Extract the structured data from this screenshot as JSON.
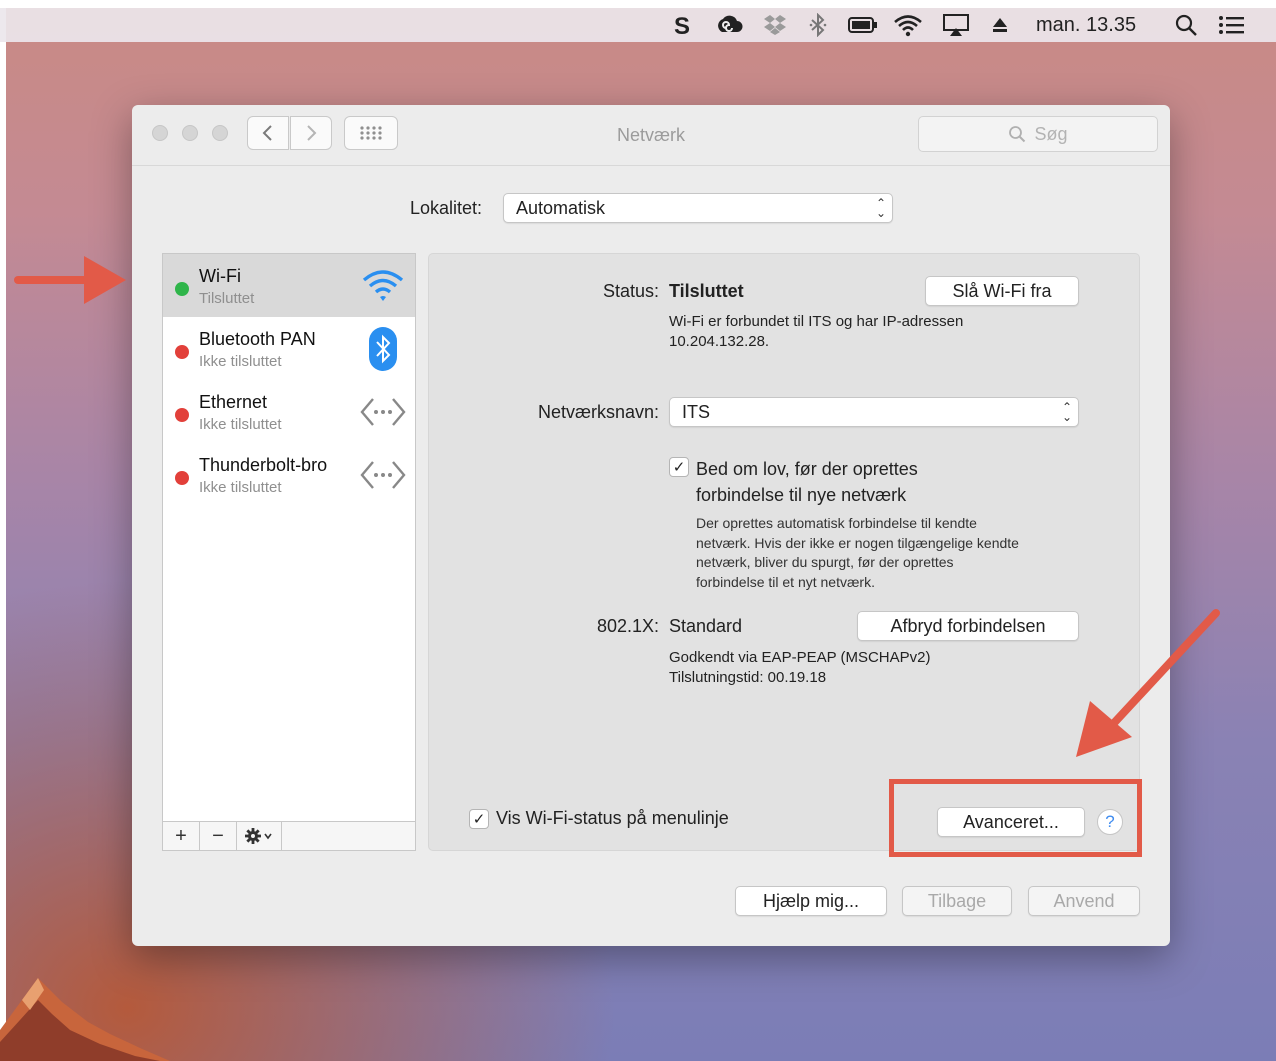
{
  "menubar": {
    "icons": [
      "skype-icon",
      "creative-cloud-icon",
      "dropbox-icon",
      "bluetooth-icon",
      "battery-icon",
      "wifi-icon",
      "airplay-icon",
      "eject-icon",
      "spotlight-icon",
      "notification-center-icon"
    ],
    "clock": "man. 13.35"
  },
  "window": {
    "title": "Netværk",
    "search_placeholder": "Søg"
  },
  "location": {
    "label": "Lokalitet:",
    "value": "Automatisk"
  },
  "services": [
    {
      "name": "Wi-Fi",
      "status": "Tilsluttet",
      "status_color": "#2fb54a",
      "icon": "wifi-icon",
      "selected": true
    },
    {
      "name": "Bluetooth PAN",
      "status": "Ikke tilsluttet",
      "status_color": "#e2403a",
      "icon": "bluetooth-icon",
      "selected": false
    },
    {
      "name": "Ethernet",
      "status": "Ikke tilsluttet",
      "status_color": "#e2403a",
      "icon": "ethernet-arrows-icon",
      "selected": false
    },
    {
      "name": "Thunderbolt-bro",
      "status": "Ikke tilsluttet",
      "status_color": "#e2403a",
      "icon": "ethernet-arrows-icon",
      "selected": false
    }
  ],
  "sidebar_tools": {
    "add": "+",
    "remove": "−",
    "gear": "gear-icon"
  },
  "detail": {
    "status_label": "Status:",
    "status_value": "Tilsluttet",
    "wifi_off_button": "Slå Wi-Fi fra",
    "status_desc_line1": "Wi-Fi er forbundet til ITS og har IP-adressen",
    "status_desc_line2": "10.204.132.28.",
    "network_name_label": "Netværksnavn:",
    "network_name_value": "ITS",
    "ask_checkbox_checked": true,
    "ask_line1": "Bed om lov, før der oprettes",
    "ask_line2": "forbindelse til nye netværk",
    "ask_desc_line1": "Der oprettes automatisk forbindelse til kendte",
    "ask_desc_line2": "netværk. Hvis der ikke er nogen tilgængelige kendte",
    "ask_desc_line3": "netværk, bliver du spurgt, før der oprettes",
    "ask_desc_line4": "forbindelse til et nyt netværk.",
    "dot1x_label": "802.1X:",
    "dot1x_value": "Standard",
    "disconnect_button": "Afbryd forbindelsen",
    "auth_line1": "Godkendt via EAP-PEAP (MSCHAPv2)",
    "auth_line2": "Tilslutningstid: 00.19.18",
    "show_status_checked": true,
    "show_status_label": "Vis Wi-Fi-status på menulinje",
    "advanced_button": "Avanceret...",
    "help_symbol": "?"
  },
  "footer": {
    "assist_button": "Hjælp mig...",
    "revert_button": "Tilbage",
    "apply_button": "Anvend"
  },
  "colors": {
    "annotation": "#e25a48",
    "connected": "#2fb54a",
    "disconnected": "#e2403a",
    "bluetooth_blue": "#2a8ff0"
  }
}
